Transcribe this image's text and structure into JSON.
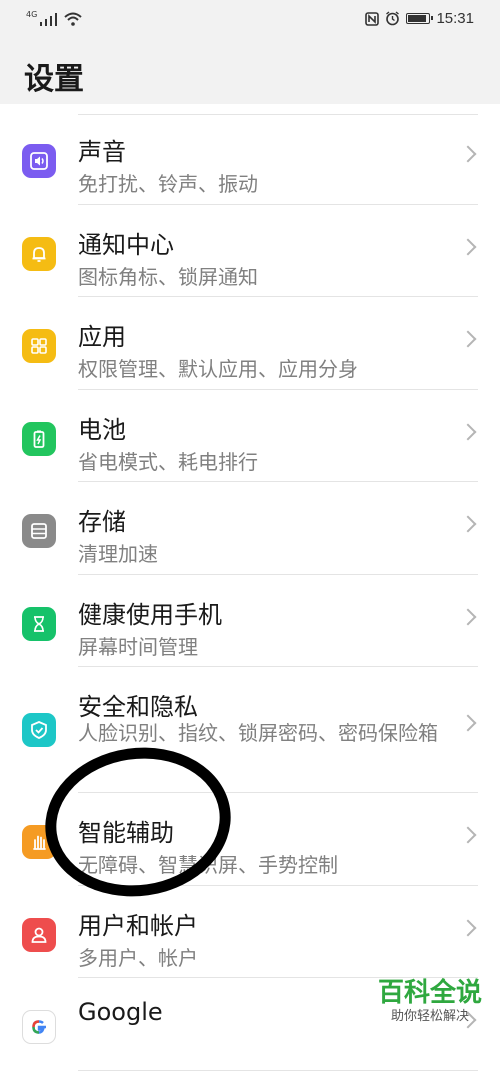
{
  "status_bar": {
    "network": "4G",
    "time": "15:31",
    "icons": [
      "signal-icon",
      "wifi-icon",
      "nfc-icon",
      "alarm-icon",
      "battery-icon"
    ]
  },
  "header": {
    "title": "设置"
  },
  "items": [
    {
      "title": "声音",
      "subtitle": "免打扰、铃声、振动",
      "icon": "sound-icon",
      "color": "#7b5cf0"
    },
    {
      "title": "通知中心",
      "subtitle": "图标角标、锁屏通知",
      "icon": "bell-icon",
      "color": "#f5bc13"
    },
    {
      "title": "应用",
      "subtitle": "权限管理、默认应用、应用分身",
      "icon": "apps-grid-icon",
      "color": "#f5bc13"
    },
    {
      "title": "电池",
      "subtitle": "省电模式、耗电排行",
      "icon": "battery-icon",
      "color": "#22c55e"
    },
    {
      "title": "存储",
      "subtitle": "清理加速",
      "icon": "storage-icon",
      "color": "#8a8a8a"
    },
    {
      "title": "健康使用手机",
      "subtitle": "屏幕时间管理",
      "icon": "hourglass-icon",
      "color": "#16c26a"
    },
    {
      "title": "安全和隐私",
      "subtitle": "人脸识别、指纹、锁屏密码、密码保险箱",
      "icon": "shield-icon",
      "color": "#1dc7c7"
    },
    {
      "title": "智能辅助",
      "subtitle": "无障碍、智慧识屏、手势控制",
      "icon": "hand-icon",
      "color": "#f59b23"
    },
    {
      "title": "用户和帐户",
      "subtitle": "多用户、帐户",
      "icon": "user-icon",
      "color": "#ee4d4d"
    },
    {
      "title": "Google",
      "subtitle": "",
      "icon": "google-icon",
      "color": "#ffffff"
    }
  ],
  "watermark": {
    "title": "百科全说",
    "subtitle": "助你轻松解决"
  }
}
